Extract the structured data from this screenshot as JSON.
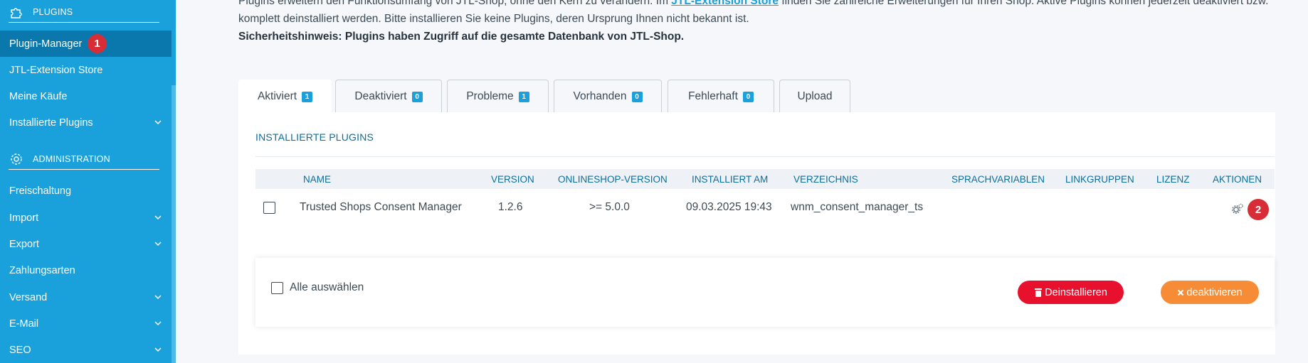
{
  "sidebar": {
    "plugins_heading": "PLUGINS",
    "admin_heading": "ADMINISTRATION",
    "items": [
      {
        "label": "Plugin-Manager",
        "badge": "1"
      },
      {
        "label": "JTL-Extension Store"
      },
      {
        "label": "Meine Käufe"
      },
      {
        "label": "Installierte Plugins"
      },
      {
        "label": "Freischaltung"
      },
      {
        "label": "Import"
      },
      {
        "label": "Export"
      },
      {
        "label": "Zahlungsarten"
      },
      {
        "label": "Versand"
      },
      {
        "label": "E-Mail"
      },
      {
        "label": "SEO"
      }
    ]
  },
  "intro": {
    "line1_pre": "Plugins erweitern den Funktionsumfang von JTL-Shop, ohne den Kern zu verändern. Im ",
    "line1_link": "JTL-Extension Store",
    "line1_post": " finden Sie zahlreiche Erweiterungen für Ihren Shop. Aktive Plugins können jederzeit deaktiviert bzw.",
    "line2": "komplett deinstalliert werden. Bitte installieren Sie keine Plugins, deren Ursprung Ihnen nicht bekannt ist.",
    "line3": "Sicherheitshinweis: Plugins haben Zugriff auf die gesamte Datenbank von JTL-Shop."
  },
  "tabs": [
    {
      "label": "Aktiviert",
      "count": "1"
    },
    {
      "label": "Deaktiviert",
      "count": "0"
    },
    {
      "label": "Probleme",
      "count": "1"
    },
    {
      "label": "Vorhanden",
      "count": "0"
    },
    {
      "label": "Fehlerhaft",
      "count": "0"
    },
    {
      "label": "Upload"
    }
  ],
  "panel": {
    "title": "INSTALLIERTE PLUGINS",
    "columns": [
      "NAME",
      "VERSION",
      "ONLINESHOP-VERSION",
      "INSTALLIERT AM",
      "VERZEICHNIS",
      "SPRACHVARIABLEN",
      "LINKGRUPPEN",
      "LIZENZ",
      "AKTIONEN"
    ],
    "rows": [
      {
        "name": "Trusted Shops Consent Manager",
        "version": "1.2.6",
        "shop_version": ">= 5.0.0",
        "installed": "09.03.2025 19:43",
        "directory": "wnm_consent_manager_ts",
        "action_badge": "2"
      }
    ],
    "select_all": "Alle auswählen",
    "uninstall": "Deinstallieren",
    "deactivate": "deaktivieren"
  },
  "colors": {
    "sidebar": "#1aa0db",
    "active": "#0a78ad",
    "badge": "#d82c37",
    "danger": "#e8112d",
    "warning": "#f68c36"
  }
}
